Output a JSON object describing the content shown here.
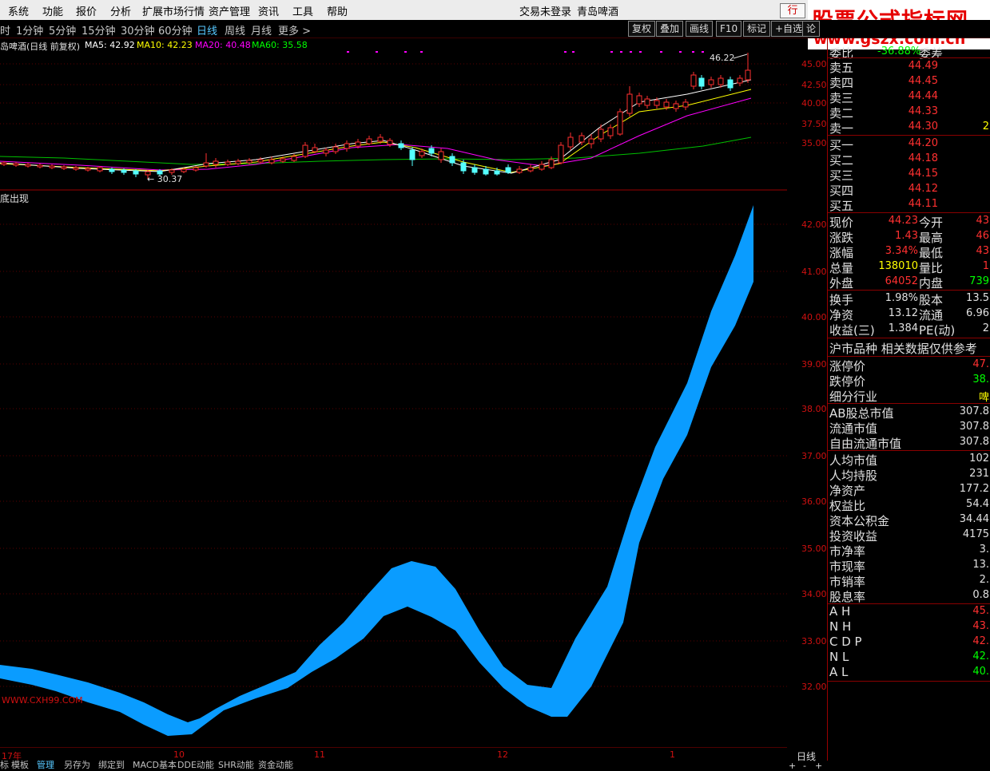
{
  "menu": {
    "items": [
      "系统",
      "功能",
      "报价",
      "分析",
      "扩展市场行情",
      "资产管理",
      "资讯",
      "工具",
      "帮助"
    ],
    "login_status": "交易未登录",
    "stock_name": "青岛啤酒",
    "trade_button": "行"
  },
  "banner": {
    "title": "股票公式指标网",
    "url": "www.gszx.com.cn"
  },
  "toolbar": {
    "periods": [
      "时",
      "1分钟",
      "5分钟",
      "15分钟",
      "30分钟",
      "60分钟",
      "日线",
      "周线",
      "月线",
      "更多 >"
    ],
    "selected": "日线",
    "buttons": [
      "复权",
      "叠加",
      "画线",
      "F10",
      "标记",
      "+自选",
      "论"
    ]
  },
  "main_chart": {
    "title": "岛啤酒(日线 前复权)",
    "ma": [
      {
        "label": "MA5: 42.92",
        "color": "#ffffff"
      },
      {
        "label": "MA10: 42.23",
        "color": "#ffff00"
      },
      {
        "label": "MA20: 40.48",
        "color": "#ff00ff"
      },
      {
        "label": "MA60: 35.58",
        "color": "#00ff00"
      }
    ],
    "high_label": "46.22",
    "low_label": "30.37",
    "axis": [
      "45.00",
      "42.50",
      "40.00",
      "37.50",
      "35.00"
    ]
  },
  "indicator": {
    "title": "底出现",
    "watermark": "WWW.CXH99.COM",
    "axis": [
      "42.00",
      "41.00",
      "40.00",
      "39.00",
      "38.00",
      "37.00",
      "36.00",
      "35.00",
      "34.00",
      "33.00",
      "32.00"
    ]
  },
  "dates": [
    "17年",
    "10",
    "11",
    "12",
    "1"
  ],
  "period_label": "日线",
  "bottom_tabs": [
    "标",
    "模板",
    "管理",
    "另存为",
    "绑定到",
    "MACD基本",
    "DDE动能",
    "SHR动能",
    "资金动能"
  ],
  "quote": {
    "weibi": {
      "label": "委比",
      "value": "-36.88%",
      "extra": "委差"
    },
    "asks": [
      {
        "label": "卖五",
        "price": "44.49"
      },
      {
        "label": "卖四",
        "price": "44.45"
      },
      {
        "label": "卖三",
        "price": "44.44"
      },
      {
        "label": "卖二",
        "price": "44.33"
      },
      {
        "label": "卖一",
        "price": "44.30",
        "vol": "2"
      }
    ],
    "bids": [
      {
        "label": "买一",
        "price": "44.20"
      },
      {
        "label": "买二",
        "price": "44.18"
      },
      {
        "label": "买三",
        "price": "44.15"
      },
      {
        "label": "买四",
        "price": "44.12"
      },
      {
        "label": "买五",
        "price": "44.11"
      }
    ],
    "stats1": [
      {
        "l1": "现价",
        "v1": "44.23",
        "c1": "#ff3030",
        "l2": "今开",
        "v2": "43",
        "c2": "#ff3030"
      },
      {
        "l1": "涨跌",
        "v1": "1.43",
        "c1": "#ff3030",
        "l2": "最高",
        "v2": "46",
        "c2": "#ff3030"
      },
      {
        "l1": "涨幅",
        "v1": "3.34%",
        "c1": "#ff3030",
        "l2": "最低",
        "v2": "43",
        "c2": "#ff3030"
      },
      {
        "l1": "总量",
        "v1": "138010",
        "c1": "#ffff00",
        "l2": "量比",
        "v2": "1",
        "c2": "#ff3030"
      },
      {
        "l1": "外盘",
        "v1": "64052",
        "c1": "#ff3030",
        "l2": "内盘",
        "v2": "739",
        "c2": "#00ff00"
      }
    ],
    "stats2": [
      {
        "l1": "换手",
        "v1": "1.98%",
        "c1": "#e0e0e0",
        "l2": "股本",
        "v2": "13.5",
        "c2": "#e0e0e0"
      },
      {
        "l1": "净资",
        "v1": "13.12",
        "c1": "#e0e0e0",
        "l2": "流通",
        "v2": "6.96",
        "c2": "#e0e0e0"
      },
      {
        "l1": "收益(三)",
        "v1": "1.384",
        "c1": "#e0e0e0",
        "l2": "PE(动)",
        "v2": "2",
        "c2": "#e0e0e0"
      }
    ],
    "notice": "沪市品种 相关数据仅供参考",
    "limits": [
      {
        "label": "涨停价",
        "value": "47.",
        "color": "#ff3030"
      },
      {
        "label": "跌停价",
        "value": "38.",
        "color": "#00ff00"
      },
      {
        "label": "细分行业",
        "value": "啤",
        "color": "#ffff00"
      }
    ],
    "mcap": [
      {
        "label": "AB股总市值",
        "value": "307.8"
      },
      {
        "label": "流通市值",
        "value": "307.8"
      },
      {
        "label": "自由流通市值",
        "value": "307.8"
      }
    ],
    "fund": [
      {
        "label": "人均市值",
        "value": "102"
      },
      {
        "label": "人均持股",
        "value": "231"
      },
      {
        "label": "净资产",
        "value": "177.2"
      },
      {
        "label": "权益比",
        "value": "54.4"
      },
      {
        "label": "资本公积金",
        "value": "34.44"
      },
      {
        "label": "投资收益",
        "value": "4175"
      },
      {
        "label": "市净率",
        "value": "3."
      },
      {
        "label": "市现率",
        "value": "13."
      },
      {
        "label": "市销率",
        "value": "2."
      },
      {
        "label": "股息率",
        "value": "0.8"
      }
    ],
    "ah": [
      {
        "label": "A H",
        "value": "45.",
        "color": "#ff3030"
      },
      {
        "label": "N H",
        "value": "43.",
        "color": "#ff3030"
      },
      {
        "label": "C D P",
        "value": "42.",
        "color": "#ff3030"
      },
      {
        "label": "N L",
        "value": "42.",
        "color": "#00ff00"
      },
      {
        "label": "A L",
        "value": "40.",
        "color": "#00ff00"
      }
    ]
  }
}
